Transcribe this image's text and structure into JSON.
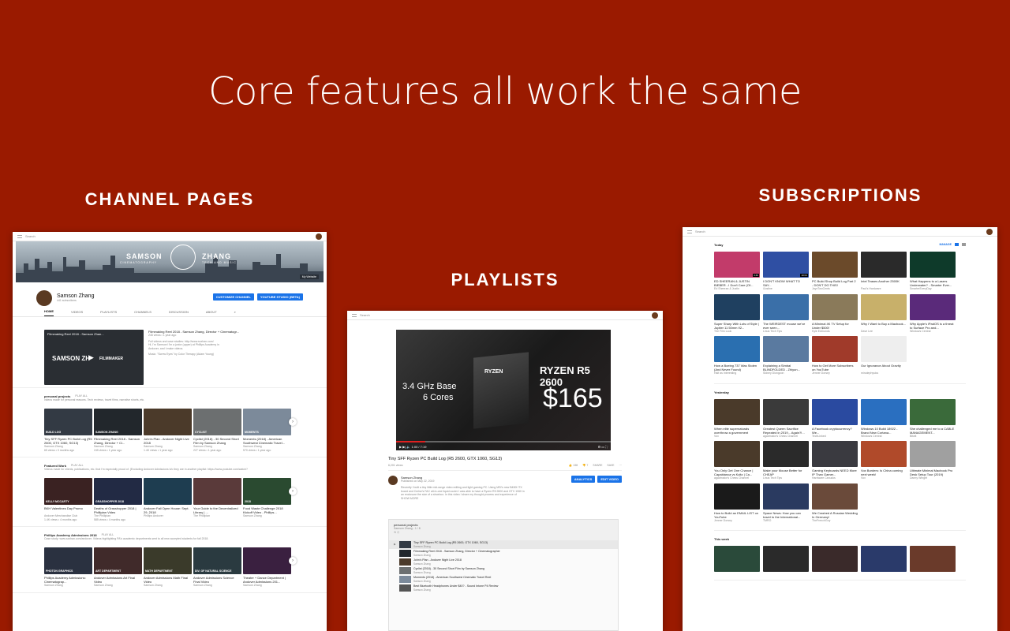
{
  "headline": "Core features all work the same",
  "sections": {
    "channel": "CHANNEL PAGES",
    "playlists": "PLAYLISTS",
    "subscriptions": "SUBSCRIPTIONS"
  },
  "colors": {
    "page_bg": "#9a1a00",
    "accent": "#1a73e8",
    "text": "#ffffff"
  },
  "channel_page": {
    "search_placeholder": "Search",
    "banner_left": "SAMSON",
    "banner_sub": "CINEMATOGRAPHY",
    "banner_right": "ZHANG",
    "banner_sub2": "TECH AND MUSIC",
    "banner_links": "My Website",
    "channel_name": "Samson Zhang",
    "subscribers": "441 subscribers",
    "btn_customize": "CUSTOMIZE CHANNEL",
    "btn_studio": "YOUTUBE STUDIO (BETA)",
    "tabs": [
      "HOME",
      "VIDEOS",
      "PLAYLISTS",
      "CHANNELS",
      "DISCUSSION",
      "ABOUT"
    ],
    "featured": {
      "thumb_title": "Filmmaking Reel 2018 - Samson Zhan...",
      "thumb_text": "SAMSON ZH",
      "thumb_text2": "FILMMAKER",
      "title": "Filmmaking Reel 2018 - Samson Zhang, Director + Cinematogr...",
      "meta": "245 views • 1 year ago",
      "desc1": "Full videos and case studies: http://www.sxzhan.com/",
      "desc2": "Hi, I'm Samson! I'm a junior (upper) at Phillips Academy in",
      "desc3": "Andover, and I make videos.",
      "desc4": "Music: \"Screw Eyes\" by Color Therapy (Adam Young)"
    },
    "shelves": [
      {
        "title": "personal projects",
        "play_all": "PLAY ALL",
        "desc": "videos made for personal reasons. Tech reviews, travel films, narrative shorts, etc.",
        "videos": [
          {
            "title": "Tiny SFF Ryzen PC Build Log (R5 2600, GTX 1060, SG13)",
            "channel": "Samson Zhang",
            "meta": "65 views • 3 months ago",
            "label": "BUILD LOG",
            "color": "#333a44"
          },
          {
            "title": "Filmmaking Reel 2018 - Samson Zhang, Director + Ci...",
            "channel": "Samson Zhang",
            "meta": "245 views • 1 year ago",
            "label": "SAMSON ZHANG",
            "color": "#22272c"
          },
          {
            "title": "John's Plan - Andover Night Live 2018",
            "channel": "Samson Zhang",
            "meta": "1.4K views • 1 year ago",
            "label": "",
            "color": "#4b3a2a"
          },
          {
            "title": "Cyclist (2018) - 30 Second Short Film by Samson Zhang",
            "channel": "Samson Zhang",
            "meta": "227 views • 1 year ago",
            "label": "CYCLIST",
            "color": "#6c6f70"
          },
          {
            "title": "Moments (2018) - American Southwest Cinematic Travel...",
            "channel": "Samson Zhang",
            "meta": "570 views • 1 year ago",
            "label": "MOMENTS",
            "color": "#7c8a9a"
          }
        ]
      },
      {
        "title": "Featured Work",
        "play_all": "PLAY ALL",
        "desc": "Videos made for clients, publications, etc. that I'm especially proud of. (Excluding Andover Admissions b/c they are in another playlist: https://www.youtube.com/watch?",
        "videos": [
          {
            "title": "BKH Valentines Day Promo",
            "channel": "Andover Merchandise Club",
            "meta": "1.4K views • 4 months ago",
            "label": "KELLY MCCARTY",
            "color": "#3a2222"
          },
          {
            "title": "Deaths of Grasshopper 2018 | Phillipian Video",
            "channel": "The Phillipian",
            "meta": "585 views • 4 months ago",
            "label": "GRASSHOPPER 2018",
            "color": "#222a44"
          },
          {
            "title": "Andover Fall Open House: Sept. 29, 2018",
            "channel": "Phillips Andover",
            "meta": "",
            "label": "",
            "color": "#1e3d50"
          },
          {
            "title": "Your Guide to the Decentralized Library | ...",
            "channel": "The Phillipian",
            "meta": "",
            "label": "",
            "color": "#5a3a3a"
          },
          {
            "title": "Food Waste Challenge 2018 Kickoff Video - Phillips...",
            "channel": "Samson Zhang",
            "meta": "",
            "label": "2018",
            "color": "#2a4a30"
          }
        ]
      },
      {
        "title": "Phillips Academy Admissions 2018",
        "play_all": "PLAY ALL",
        "desc": "Case study: www.sxzhan.com/andover. Videos highlighting PA's academic departments sent to all new accepted students for fall 2018.",
        "videos": [
          {
            "title": "Phillips Academy Admissions: Cinematograp...",
            "channel": "Samson Zhang",
            "meta": "",
            "label": "PHOTON GRAPHICS",
            "color": "#2a3140"
          },
          {
            "title": "Andover Admissions Art Final Video",
            "channel": "Samson Zhang",
            "meta": "",
            "label": "ART DEPARTMENT",
            "color": "#402a2a"
          },
          {
            "title": "Andover Admissions Math Final Video",
            "channel": "Samson Zhang",
            "meta": "",
            "label": "MATH DEPARTMENT",
            "color": "#3a3a2a"
          },
          {
            "title": "Andover Admissions Science Final Video",
            "channel": "Samson Zhang",
            "meta": "",
            "label": "DIV. OF NATURAL SCIENCE",
            "color": "#2a3a40"
          },
          {
            "title": "Theater + Dance Department | Andover Admissions 201...",
            "channel": "Samson Zhang",
            "meta": "",
            "label": "",
            "color": "#3a2040"
          }
        ]
      }
    ]
  },
  "playlist_page": {
    "search_placeholder": "Search",
    "player_text1": "3.4 GHz Base",
    "player_text2": "6 Cores",
    "player_text3": "RYZEN R5 2600",
    "player_text4": "$165",
    "time": "1:00 / 7:19",
    "video_title": "Tiny SFF Ryzen PC Build Log (R5 2600, GTX 1060, SG13)",
    "views": "6,201 views",
    "likes": "138",
    "dislikes": "7",
    "share": "SHARE",
    "save": "SAVE",
    "channel": "Samson Zhang",
    "published": "Published on May 22, 2019",
    "btn_analytics": "ANALYTICS",
    "btn_edit": "EDIT VIDEO",
    "desc1": "Recently I built a tiny little mid-range video editing and light gaming PC. Using MSI's new B450I ITX",
    "desc2": "board and Cerise's FAC all-in-one liquid cooler I was able to have a Ryzen R5 2600 and GTX 1060 in",
    "desc3": "an enclosure the size of a shoebox. In this video I share my thought process and experience of",
    "show_more": "SHOW MORE",
    "playlist_title": "personal projects",
    "playlist_meta": "Samson Zhang - 1 / 8",
    "items": [
      {
        "title": "Tiny SFF Ryzen PC Build Log (R5 2600, GTX 1060, SG13)",
        "channel": "Samson Zhang",
        "color": "#333a44"
      },
      {
        "title": "Filmmaking Reel 2018 - Samson Zhang, Director + Cinematographer",
        "channel": "Samson Zhang",
        "color": "#22272c"
      },
      {
        "title": "John's Plan - Andover Night Live 2018",
        "channel": "Samson Zhang",
        "color": "#4b3a2a"
      },
      {
        "title": "Cyclist (2018) - 30 Second Short Film by Samson Zhang",
        "channel": "Samson Zhang",
        "color": "#6c6f70"
      },
      {
        "title": "Moments (2018) - American Southwest Cinematic Travel Reel",
        "channel": "Samson Zhang",
        "color": "#7c8a9a"
      },
      {
        "title": "Best Bluetooth Headphones Under $40? - Sound Intone P4 Review",
        "channel": "Samson Zhang",
        "color": "#555555"
      }
    ]
  },
  "subs_page": {
    "search_placeholder": "Search",
    "manage": "MANAGE",
    "groups": [
      {
        "label": "Today",
        "rows": [
          [
            {
              "title": "ED SHEERAN & JUSTIN BIEBER - I Don't Care (Of...",
              "channel": "Ed Sheeran & Justin",
              "meta": "",
              "dur": "3:40",
              "color": "#c23b6a"
            },
            {
              "title": "I DON'T KNOW WHAT TO SAY...",
              "channel": "iJustine",
              "meta": "",
              "dur": "10:01",
              "color": "#2f4fa3"
            },
            {
              "title": "PC Build Shop Build Log Part 2 - DON'T DO THIS!",
              "channel": "JayzTwoCents",
              "meta": "",
              "dur": "",
              "color": "#6b4a2a"
            },
            {
              "title": "Intel Teases Another 2500K",
              "channel": "Paul's Hardware",
              "meta": "",
              "dur": "",
              "color": "#2a2a2a"
            },
            {
              "title": "What Happens to a Lasers Underwater? - Smarter Ever...",
              "channel": "SmarterEveryDay",
              "meta": "",
              "dur": "",
              "color": "#0e3a2a"
            }
          ],
          [
            {
              "title": "Super Sharp With Lots of Style | Jupiter 11 50mm f/2...",
              "channel": "The Film Look",
              "meta": "",
              "dur": "",
              "color": "#1f4060"
            },
            {
              "title": "The WEIRDEST mouse we've ever seen...",
              "channel": "Linus Tech Tips",
              "meta": "",
              "dur": "",
              "color": "#3a6fa8"
            },
            {
              "title": "A Minimal 4K TV Setup for Under $500!",
              "channel": "Kyle Edmonds",
              "meta": "",
              "dur": "",
              "color": "#8a7a5a"
            },
            {
              "title": "Why I Want to Buy a Macbook...",
              "channel": "Dave Lee",
              "meta": "",
              "dur": "",
              "color": "#c8b06a"
            },
            {
              "title": "Why Apple's iPadOS is a threat to Surface Pro and...",
              "channel": "Windows Central",
              "meta": "",
              "dur": "",
              "color": "#5a2a7a"
            }
          ],
          [
            {
              "title": "How a Boeing 737 Was Stolen (And Never Found)",
              "channel": "Half as Interesting",
              "meta": "",
              "dur": "",
              "color": "#2a6fb0"
            },
            {
              "title": "Explaining a Simbal BLINDFOLDED - Zhiyun...",
              "channel": "Sidney Diongzon",
              "meta": "",
              "dur": "",
              "color": "#5a7aa0"
            },
            {
              "title": "How to Get More Subscribers on YouTube",
              "channel": "Jenner Dorsey",
              "meta": "",
              "dur": "",
              "color": "#a03a2a"
            },
            {
              "title": "Our Ignorance About Gravity",
              "channel": "minutephysics",
              "meta": "",
              "dur": "",
              "color": "#eeeeee"
            }
          ]
        ]
      },
      {
        "label": "Yesterday",
        "rows": [
          [
            {
              "title": "When elite supernaturals overthrow a government",
              "channel": "Vox",
              "meta": "",
              "dur": "",
              "color": "#4a3a2a"
            },
            {
              "title": "Greatest Queen Sacrifice Repeated in 2019... Again?!...",
              "channel": "agadmator's Chess Channel",
              "meta": "",
              "dur": "",
              "color": "#3a3a3a"
            },
            {
              "title": "A Facebook cryptocurrency? We...",
              "channel": "TechLinked",
              "meta": "",
              "dur": "",
              "color": "#2a4aa0"
            },
            {
              "title": "Windows 10 Build 18922 - Brand New Cortana...",
              "channel": "Windows Central",
              "meta": "",
              "dur": "",
              "color": "#2a6fc0"
            },
            {
              "title": "She challenged me to a CABLE MANAGEMENT...",
              "channel": "Bitwit",
              "meta": "",
              "dur": "",
              "color": "#3a6a3a"
            }
          ],
          [
            {
              "title": "You Only Get One Chance | Capablanca vs Koltz | Ca...",
              "channel": "agadmator's Chess Channel",
              "meta": "",
              "dur": "",
              "color": "#4a3a2a"
            },
            {
              "title": "Make your Mouse Better for CHEAP",
              "channel": "Linus Tech Tips",
              "meta": "",
              "dur": "",
              "color": "#2a2a2a"
            },
            {
              "title": "Gaming Keyboards NEED More IP Than Gamer...",
              "channel": "Hardware Canucks",
              "meta": "",
              "dur": "",
              "color": "#3a3a40"
            },
            {
              "title": "Vox Borders: Is China coming next week!",
              "channel": "Vox",
              "meta": "",
              "dur": "",
              "color": "#b04a2a"
            },
            {
              "title": "Ultimate Minimal Macbook Pro Desk Setup Tour (2019)",
              "channel": "Danny Winget",
              "meta": "",
              "dur": "",
              "color": "#a0a0a0"
            }
          ],
          [
            {
              "title": "How to Build an EMAIL LIST on YouTube",
              "channel": "Jenner Dorsey",
              "meta": "",
              "dur": "",
              "color": "#1a1a1a"
            },
            {
              "title": "Space News: How you can travel to the International...",
              "channel": "TMRO",
              "meta": "",
              "dur": "",
              "color": "#2a3a60"
            },
            {
              "title": "We Crashed A Russian Wedding In Germany!",
              "channel": "TheFrenchGuy",
              "meta": "",
              "dur": "",
              "color": "#6a4a3a"
            }
          ]
        ]
      },
      {
        "label": "This week",
        "rows": [
          [
            {
              "title": "",
              "channel": "",
              "meta": "",
              "dur": "",
              "color": "#2a4a3a"
            },
            {
              "title": "",
              "channel": "",
              "meta": "",
              "dur": "",
              "color": "#2a2a2a"
            },
            {
              "title": "",
              "channel": "",
              "meta": "",
              "dur": "",
              "color": "#3a2a2a"
            },
            {
              "title": "",
              "channel": "",
              "meta": "",
              "dur": "",
              "color": "#2a3a6a"
            },
            {
              "title": "",
              "channel": "",
              "meta": "",
              "dur": "",
              "color": "#6a3a2a"
            }
          ]
        ]
      }
    ]
  }
}
